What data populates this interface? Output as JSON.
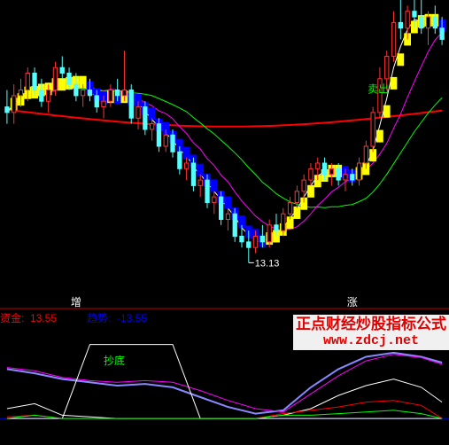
{
  "chart_data": [
    {
      "type": "candlestick",
      "title": "",
      "min_label": "13.13",
      "annotation_sell": "卖出",
      "colors": {
        "up_candle": "#ff3232",
        "down_candle": "#54ffff",
        "trend_up": "#ffff00",
        "trend_down": "#0000ff",
        "ma_short": "#ffffff",
        "ma_mid": "#ff00ff",
        "ma_long": "#00ff00",
        "ma_slow": "#ff0000"
      },
      "ylim": [
        12.6,
        17.8
      ],
      "candles": [
        [
          15.9,
          16.2,
          15.6,
          15.8
        ],
        [
          15.8,
          16.3,
          15.6,
          16.1
        ],
        [
          16.1,
          16.4,
          15.9,
          16.2
        ],
        [
          16.2,
          16.6,
          16.0,
          16.5
        ],
        [
          16.5,
          16.6,
          16.1,
          16.2
        ],
        [
          16.2,
          16.4,
          15.9,
          16.0
        ],
        [
          16.0,
          16.3,
          15.8,
          16.2
        ],
        [
          16.2,
          16.7,
          16.1,
          16.6
        ],
        [
          16.6,
          16.8,
          16.4,
          16.5
        ],
        [
          16.5,
          16.6,
          16.2,
          16.3
        ],
        [
          16.3,
          16.5,
          16.0,
          16.1
        ],
        [
          16.1,
          16.3,
          15.9,
          16.2
        ],
        [
          16.2,
          16.4,
          16.0,
          16.1
        ],
        [
          16.1,
          16.2,
          15.8,
          15.9
        ],
        [
          15.9,
          16.1,
          15.7,
          16.0
        ],
        [
          16.0,
          16.3,
          15.9,
          16.2
        ],
        [
          16.2,
          16.4,
          16.0,
          16.1
        ],
        [
          16.1,
          16.9,
          16.0,
          16.2
        ],
        [
          16.2,
          16.3,
          15.6,
          15.7
        ],
        [
          15.7,
          16.0,
          15.5,
          15.9
        ],
        [
          15.9,
          16.0,
          15.4,
          15.5
        ],
        [
          15.5,
          15.7,
          15.3,
          15.6
        ],
        [
          15.6,
          15.7,
          15.1,
          15.2
        ],
        [
          15.2,
          15.5,
          15.1,
          15.4
        ],
        [
          15.4,
          15.5,
          15.0,
          15.1
        ],
        [
          15.1,
          15.2,
          14.7,
          14.8
        ],
        [
          14.8,
          15.0,
          14.6,
          14.9
        ],
        [
          14.9,
          15.0,
          14.4,
          14.5
        ],
        [
          14.5,
          14.7,
          14.3,
          14.6
        ],
        [
          14.6,
          14.7,
          14.1,
          14.2
        ],
        [
          14.2,
          14.4,
          14.0,
          14.3
        ],
        [
          14.3,
          14.4,
          13.8,
          13.9
        ],
        [
          13.9,
          14.1,
          13.7,
          14.0
        ],
        [
          14.0,
          14.1,
          13.5,
          13.6
        ],
        [
          13.6,
          13.8,
          13.4,
          13.5
        ],
        [
          13.5,
          13.7,
          13.13,
          13.4
        ],
        [
          13.4,
          13.7,
          13.3,
          13.6
        ],
        [
          13.6,
          13.8,
          13.4,
          13.5
        ],
        [
          13.5,
          13.9,
          13.4,
          13.8
        ],
        [
          13.8,
          14.0,
          13.6,
          13.7
        ],
        [
          13.7,
          14.1,
          13.6,
          14.0
        ],
        [
          14.0,
          14.3,
          13.9,
          14.2
        ],
        [
          14.2,
          14.5,
          14.1,
          14.4
        ],
        [
          14.4,
          14.7,
          14.2,
          14.6
        ],
        [
          14.6,
          14.9,
          14.5,
          14.8
        ],
        [
          14.8,
          15.0,
          14.6,
          14.9
        ],
        [
          14.9,
          15.0,
          14.6,
          14.7
        ],
        [
          14.7,
          14.9,
          14.5,
          14.8
        ],
        [
          14.8,
          14.9,
          14.5,
          14.6
        ],
        [
          14.6,
          14.8,
          14.4,
          14.7
        ],
        [
          14.7,
          14.8,
          14.5,
          14.6
        ],
        [
          14.6,
          15.0,
          14.5,
          14.9
        ],
        [
          14.9,
          15.3,
          14.8,
          15.2
        ],
        [
          15.2,
          15.9,
          15.1,
          15.8
        ],
        [
          15.8,
          16.6,
          15.7,
          16.4
        ],
        [
          16.4,
          16.9,
          16.2,
          16.8
        ],
        [
          16.8,
          17.6,
          16.7,
          17.4
        ],
        [
          17.4,
          17.8,
          17.1,
          17.3
        ],
        [
          17.3,
          17.7,
          17.1,
          17.6
        ],
        [
          17.6,
          17.8,
          17.3,
          17.5
        ],
        [
          17.5,
          17.8,
          17.2,
          17.3
        ],
        [
          17.3,
          17.6,
          17.0,
          17.5
        ],
        [
          17.5,
          17.7,
          17.2,
          17.3
        ],
        [
          17.3,
          17.5,
          17.0,
          17.1
        ]
      ]
    },
    {
      "type": "line",
      "title": "",
      "legend": [
        {
          "name": "资金",
          "value": "13.55",
          "color": "#ff0000"
        },
        {
          "name": "趋势",
          "value": "-13.55",
          "color": "#0000ff"
        }
      ],
      "markers": [
        {
          "label": "增",
          "color": "#ffffff",
          "at_index": 10
        },
        {
          "label": "涨",
          "color": "#ffffff",
          "at_index": 50
        }
      ],
      "annotation": "抄底",
      "ylim": [
        -30,
        110
      ],
      "x": [
        0,
        4,
        8,
        12,
        16,
        20,
        24,
        28,
        32,
        36,
        40,
        44,
        48,
        52,
        56,
        60,
        63
      ],
      "series": [
        {
          "name": "",
          "color": "#8888ff",
          "values": [
            60,
            55,
            48,
            44,
            40,
            42,
            38,
            26,
            14,
            6,
            10,
            38,
            60,
            75,
            80,
            75,
            68
          ]
        },
        {
          "name": "",
          "color": "#ff00ff",
          "values": [
            62,
            58,
            50,
            46,
            44,
            46,
            44,
            34,
            22,
            12,
            8,
            30,
            52,
            70,
            78,
            74,
            66
          ]
        },
        {
          "name": "",
          "color": "#ffffff",
          "values": [
            12,
            18,
            4,
            2,
            0,
            0,
            0,
            0,
            0,
            0,
            4,
            12,
            28,
            40,
            48,
            38,
            20
          ]
        },
        {
          "name": "",
          "color": "#ffffff",
          "values": [
            0,
            0,
            0,
            90,
            90,
            90,
            90,
            0,
            0,
            0,
            0,
            0,
            0,
            0,
            0,
            0,
            0
          ]
        },
        {
          "name": "",
          "color": "#ff0000",
          "values": [
            2,
            4,
            0,
            0,
            0,
            0,
            0,
            0,
            0,
            0,
            6,
            10,
            14,
            20,
            22,
            16,
            0
          ]
        },
        {
          "name": "",
          "color": "#00ff00",
          "values": [
            0,
            4,
            0,
            0,
            0,
            0,
            0,
            0,
            0,
            0,
            4,
            4,
            6,
            8,
            10,
            6,
            0
          ]
        }
      ]
    }
  ],
  "watermark": {
    "title": "正点财经炒股指标公式",
    "url": "www.zdcj.net"
  }
}
